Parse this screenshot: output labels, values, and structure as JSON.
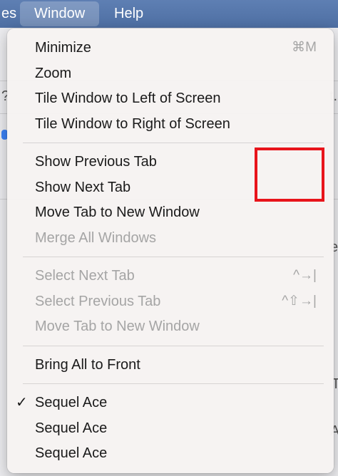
{
  "menubar": {
    "items": [
      {
        "label": "es"
      },
      {
        "label": "Window"
      },
      {
        "label": "Help"
      }
    ]
  },
  "background": {
    "glyphs": [
      "?",
      "t.",
      "e",
      "T",
      "A"
    ]
  },
  "menu": {
    "groups": [
      [
        {
          "label": "Minimize",
          "shortcut": "⌘M",
          "enabled": true
        },
        {
          "label": "Zoom",
          "shortcut": "",
          "enabled": true
        },
        {
          "label": "Tile Window to Left of Screen",
          "shortcut": "",
          "enabled": true
        },
        {
          "label": "Tile Window to Right of Screen",
          "shortcut": "",
          "enabled": true
        }
      ],
      [
        {
          "label": "Show Previous Tab",
          "shortcut": "",
          "enabled": true
        },
        {
          "label": "Show Next Tab",
          "shortcut": "",
          "enabled": true
        },
        {
          "label": "Move Tab to New Window",
          "shortcut": "",
          "enabled": true
        },
        {
          "label": "Merge All Windows",
          "shortcut": "",
          "enabled": false
        }
      ],
      [
        {
          "label": "Select Next Tab",
          "shortcut": "^→|",
          "enabled": false
        },
        {
          "label": "Select Previous Tab",
          "shortcut": "^⇧→|",
          "enabled": false
        },
        {
          "label": "Move Tab to New Window",
          "shortcut": "",
          "enabled": false
        }
      ],
      [
        {
          "label": "Bring All to Front",
          "shortcut": "",
          "enabled": true
        }
      ],
      [
        {
          "label": "Sequel Ace",
          "shortcut": "",
          "enabled": true,
          "checked": true
        },
        {
          "label": "Sequel Ace",
          "shortcut": "",
          "enabled": true,
          "checked": false
        },
        {
          "label": "Sequel Ace",
          "shortcut": "",
          "enabled": true,
          "checked": false
        }
      ]
    ]
  },
  "check_glyph": "✓",
  "colors": {
    "menubar": "#5a7bb0",
    "highlight_box": "#e8141b",
    "disabled_text": "#a5a5a5"
  }
}
